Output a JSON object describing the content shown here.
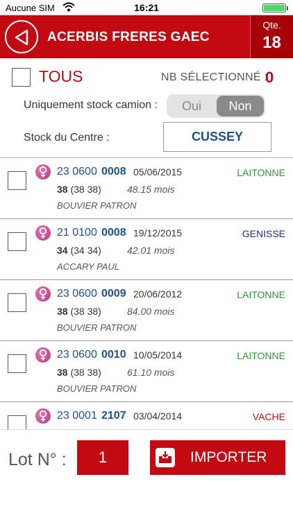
{
  "status_bar": {
    "carrier": "Aucune SIM",
    "time": "16:21",
    "battery_level": 1.0
  },
  "header": {
    "title": "ACERBIS FRERES GAEC",
    "qte_label": "Qte.",
    "qte_value": "18",
    "color": "#c30a12"
  },
  "selection": {
    "tous_label": "TOUS",
    "nb_selected_label": "NB SÉLECTIONNÉ :",
    "nb_selected_value": "0"
  },
  "stock_camion": {
    "label": "Uniquement stock camion :",
    "option_yes": "Oui",
    "option_no": "Non",
    "selected": "Non"
  },
  "stock_centre": {
    "label": "Stock du Centre :",
    "value": "CUSSEY"
  },
  "animals": [
    {
      "prefix": "23 0600",
      "number": "0008",
      "date": "05/06/2015",
      "type": "LAITONNE",
      "type_color": "#2e9a2e",
      "code": "38",
      "code_detail": "(38 38)",
      "age": "48.15 mois",
      "owner": "BOUVIER PATRON"
    },
    {
      "prefix": "21 0100",
      "number": "0008",
      "date": "19/12/2015",
      "type": "GENISSE",
      "type_color": "#1a2c8f",
      "code": "34",
      "code_detail": "(34 34)",
      "age": "42.01 mois",
      "owner": "ACCARY PAUL"
    },
    {
      "prefix": "23 0600",
      "number": "0009",
      "date": "20/06/2012",
      "type": "LAITONNE",
      "type_color": "#2e9a2e",
      "code": "38",
      "code_detail": "(38 38)",
      "age": "84.00 mois",
      "owner": "BOUVIER PATRON"
    },
    {
      "prefix": "23 0600",
      "number": "0010",
      "date": "10/05/2014",
      "type": "LAITONNE",
      "type_color": "#2e9a2e",
      "code": "38",
      "code_detail": "(38 38)",
      "age": "61.10 mois",
      "owner": "BOUVIER PATRON"
    },
    {
      "prefix": "23 0001",
      "number": "2107",
      "date": "03/04/2014",
      "type": "VACHE",
      "type_color": "#c30a12",
      "code": "",
      "code_detail": "",
      "age": "",
      "owner": ""
    }
  ],
  "footer": {
    "lot_label": "Lot N° :",
    "lot_value": "1",
    "import_label": "IMPORTER"
  }
}
